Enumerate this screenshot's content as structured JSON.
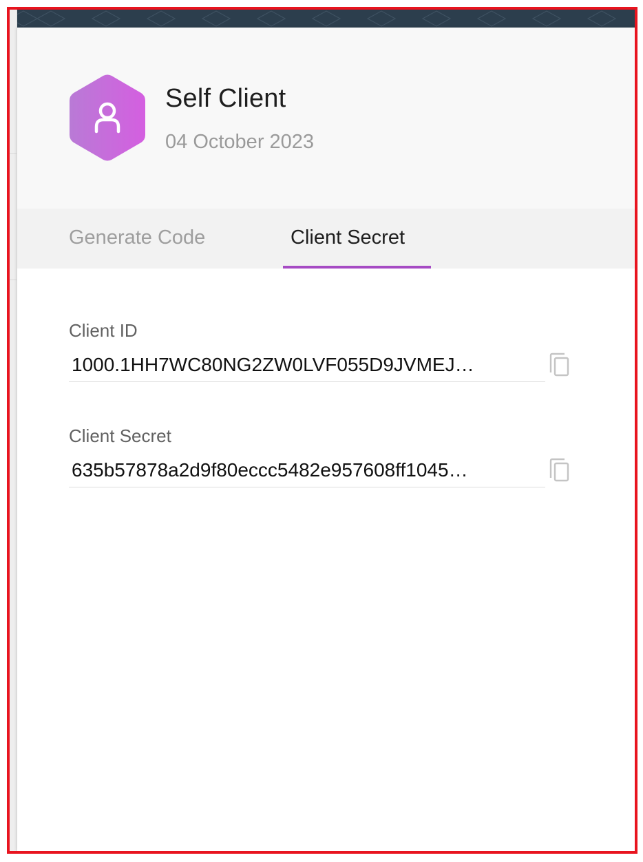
{
  "client": {
    "name": "Self Client",
    "date": "04 October 2023",
    "avatar_icon": "user-icon",
    "avatar_gradient": [
      "#b46fd6",
      "#d160e0"
    ]
  },
  "tabs": [
    {
      "label": "Generate Code",
      "active": false
    },
    {
      "label": "Client Secret",
      "active": true
    }
  ],
  "fields": {
    "client_id": {
      "label": "Client ID",
      "value": "1000.1HH7WC80NG2ZW0LVF055D9JVMEJ…",
      "copy_icon": "copy-icon"
    },
    "client_secret": {
      "label": "Client Secret",
      "value": "635b57878a2d9f80eccc5482e957608ff1045…",
      "copy_icon": "copy-icon"
    }
  },
  "colors": {
    "accent": "#a64bc4",
    "frame": "#e8141f",
    "top_strip": "#2c3e4d"
  }
}
